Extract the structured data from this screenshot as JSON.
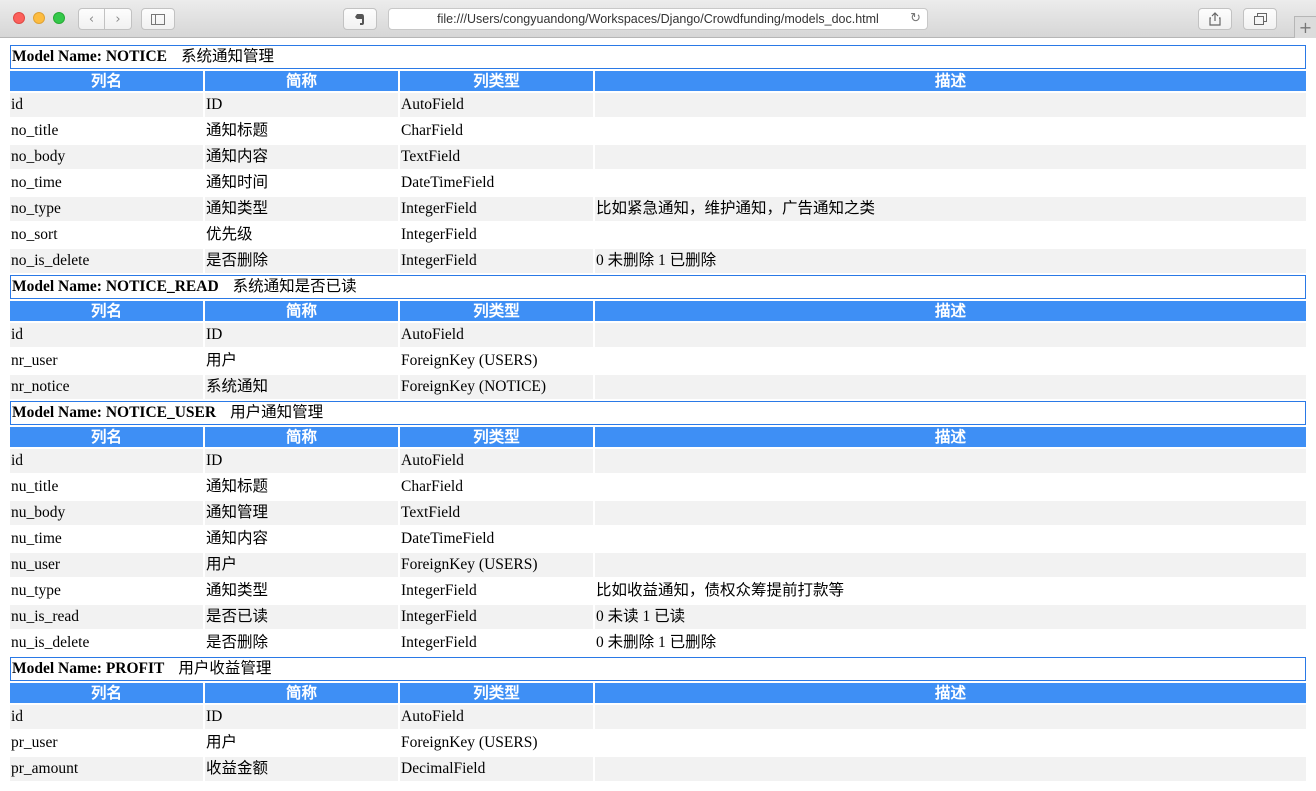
{
  "browser": {
    "url": "file:///Users/congyuandong/Workspaces/Django/Crowdfunding/models_doc.html"
  },
  "columns": [
    "列名",
    "简称",
    "列类型",
    "描述"
  ],
  "models": [
    {
      "label": "Model Name: NOTICE",
      "cn": "系统通知管理",
      "rows": [
        [
          "id",
          "ID",
          "AutoField",
          ""
        ],
        [
          "no_title",
          "通知标题",
          "CharField",
          ""
        ],
        [
          "no_body",
          "通知内容",
          "TextField",
          ""
        ],
        [
          "no_time",
          "通知时间",
          "DateTimeField",
          ""
        ],
        [
          "no_type",
          "通知类型",
          "IntegerField",
          "比如紧急通知，维护通知，广告通知之类"
        ],
        [
          "no_sort",
          "优先级",
          "IntegerField",
          ""
        ],
        [
          "no_is_delete",
          "是否删除",
          "IntegerField",
          "0 未删除 1 已删除"
        ]
      ]
    },
    {
      "label": "Model Name: NOTICE_READ",
      "cn": "系统通知是否已读",
      "rows": [
        [
          "id",
          "ID",
          "AutoField",
          ""
        ],
        [
          "nr_user",
          "用户",
          "ForeignKey (USERS)",
          ""
        ],
        [
          "nr_notice",
          "系统通知",
          "ForeignKey (NOTICE)",
          ""
        ]
      ]
    },
    {
      "label": "Model Name: NOTICE_USER",
      "cn": "用户通知管理",
      "rows": [
        [
          "id",
          "ID",
          "AutoField",
          ""
        ],
        [
          "nu_title",
          "通知标题",
          "CharField",
          ""
        ],
        [
          "nu_body",
          "通知管理",
          "TextField",
          ""
        ],
        [
          "nu_time",
          "通知内容",
          "DateTimeField",
          ""
        ],
        [
          "nu_user",
          "用户",
          "ForeignKey (USERS)",
          ""
        ],
        [
          "nu_type",
          "通知类型",
          "IntegerField",
          "比如收益通知，债权众筹提前打款等"
        ],
        [
          "nu_is_read",
          "是否已读",
          "IntegerField",
          "0 未读 1 已读"
        ],
        [
          "nu_is_delete",
          "是否删除",
          "IntegerField",
          "0 未删除 1 已删除"
        ]
      ]
    },
    {
      "label": "Model Name: PROFIT",
      "cn": "用户收益管理",
      "rows": [
        [
          "id",
          "ID",
          "AutoField",
          ""
        ],
        [
          "pr_user",
          "用户",
          "ForeignKey (USERS)",
          ""
        ],
        [
          "pr_amount",
          "收益金额",
          "DecimalField",
          ""
        ]
      ]
    }
  ]
}
